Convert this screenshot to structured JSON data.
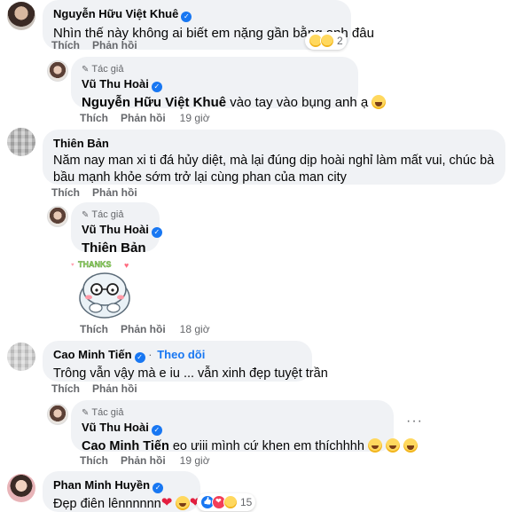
{
  "comments": [
    {
      "author": "Nguyễn Hữu Việt Khuê",
      "text": "Nhìn thế này không ai biết em nặng gần bằng anh đâu",
      "reaction_count": "2",
      "like": "Thích",
      "reply": "Phản hồi",
      "time": ""
    },
    {
      "author_tag": "Tác giả",
      "author": "Vũ Thu Hoài",
      "mention": "Nguyễn Hữu Việt Khuê",
      "text": " vào tay vào bụng anh ạ",
      "like": "Thích",
      "reply": "Phản hồi",
      "time": "19 giờ"
    },
    {
      "author": "Thiên Bản",
      "text": "Năm nay man xi ti đá hủy diệt, mà lại đúng dịp hoài nghỉ làm mất vui, chúc bà bầu mạnh khỏe sớm trở lại cùng phan của man city",
      "like": "Thích",
      "reply": "Phản hồi",
      "time": ""
    },
    {
      "author_tag": "Tác giả",
      "author": "Vũ Thu Hoài",
      "mention": "Thiên Bản",
      "sticker_text": "THANKS",
      "like": "Thích",
      "reply": "Phản hồi",
      "time": "18 giờ"
    },
    {
      "author": "Cao Minh Tiến",
      "follow": "Theo dõi",
      "text": "Trông vẫn vậy mà e iu ... vẫn xinh đẹp tuyệt trần",
      "like": "Thích",
      "reply": "Phản hồi",
      "time": ""
    },
    {
      "author_tag": "Tác giả",
      "author": "Vũ Thu Hoài",
      "mention": "Cao Minh Tiến",
      "text": " eo ưiii mình cứ khen em thíchhhh",
      "like": "Thích",
      "reply": "Phản hồi",
      "time": "19 giờ"
    },
    {
      "author": "Phan Minh Huyền",
      "text": "Đẹp điên lênnnnnn",
      "reaction_count": "15"
    }
  ],
  "icons": {
    "verified": "verified-badge-icon",
    "author_pencil": "pencil-icon"
  },
  "colors": {
    "bubble": "#f0f2f5",
    "link_blue": "#1877f2",
    "secondary_text": "#65676b"
  }
}
